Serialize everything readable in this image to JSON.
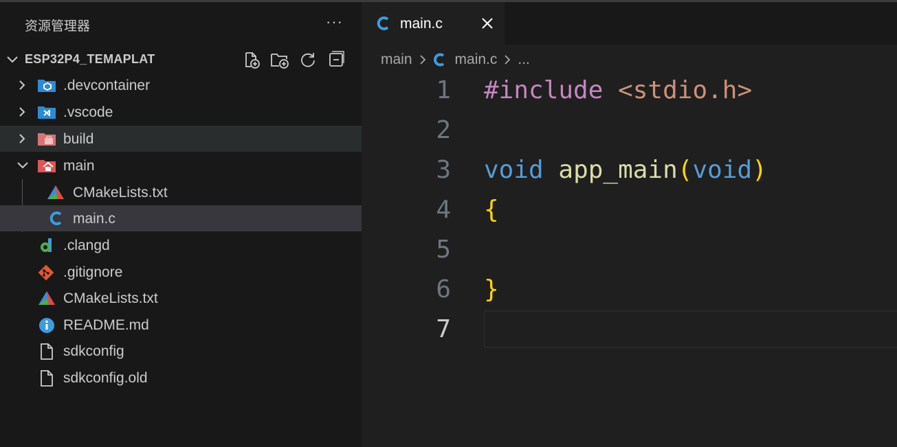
{
  "explorer": {
    "title": "资源管理器",
    "more_label": "···",
    "project": {
      "name": "ESP32P4_TEMAPLAT",
      "actions": [
        "new-file",
        "new-folder",
        "refresh",
        "collapse-all"
      ]
    },
    "tree": [
      {
        "label": ".devcontainer",
        "icon": "devcontainer-folder-icon"
      },
      {
        "label": ".vscode",
        "icon": "vscode-folder-icon"
      },
      {
        "label": "build",
        "icon": "build-folder-icon"
      },
      {
        "label": "main",
        "icon": "main-folder-icon"
      },
      {
        "label": "CMakeLists.txt",
        "icon": "cmake-icon"
      },
      {
        "label": "main.c",
        "icon": "c-file-icon"
      },
      {
        "label": ".clangd",
        "icon": "clangd-icon"
      },
      {
        "label": ".gitignore",
        "icon": "git-icon"
      },
      {
        "label": "CMakeLists.txt",
        "icon": "cmake-icon"
      },
      {
        "label": "README.md",
        "icon": "info-icon"
      },
      {
        "label": "sdkconfig",
        "icon": "file-icon"
      },
      {
        "label": "sdkconfig.old",
        "icon": "file-icon"
      }
    ]
  },
  "editor": {
    "tab": {
      "label": "main.c",
      "close_label": "×"
    },
    "breadcrumb": {
      "folder": "main",
      "file": "main.c",
      "ellipsis": "..."
    },
    "line_numbers": [
      "1",
      "2",
      "3",
      "4",
      "5",
      "6",
      "7"
    ],
    "code": {
      "l1_directive": "#include",
      "l1_header": "<stdio.h>",
      "l3_type": "void",
      "l3_func": "app_main",
      "l3_open": "(",
      "l3_param": "void",
      "l3_close": ")",
      "l4": "{",
      "l6": "}"
    }
  },
  "colors": {
    "sidebar_bg": "#181818",
    "editor_bg": "#1f1f1f",
    "selected_row": "#37373d",
    "hover_row": "#2a2d2e",
    "keyword": "#569cd6",
    "function": "#dcdcaa",
    "preprocessor": "#c586c0",
    "string": "#ce9178",
    "bracket": "#ffd700"
  }
}
